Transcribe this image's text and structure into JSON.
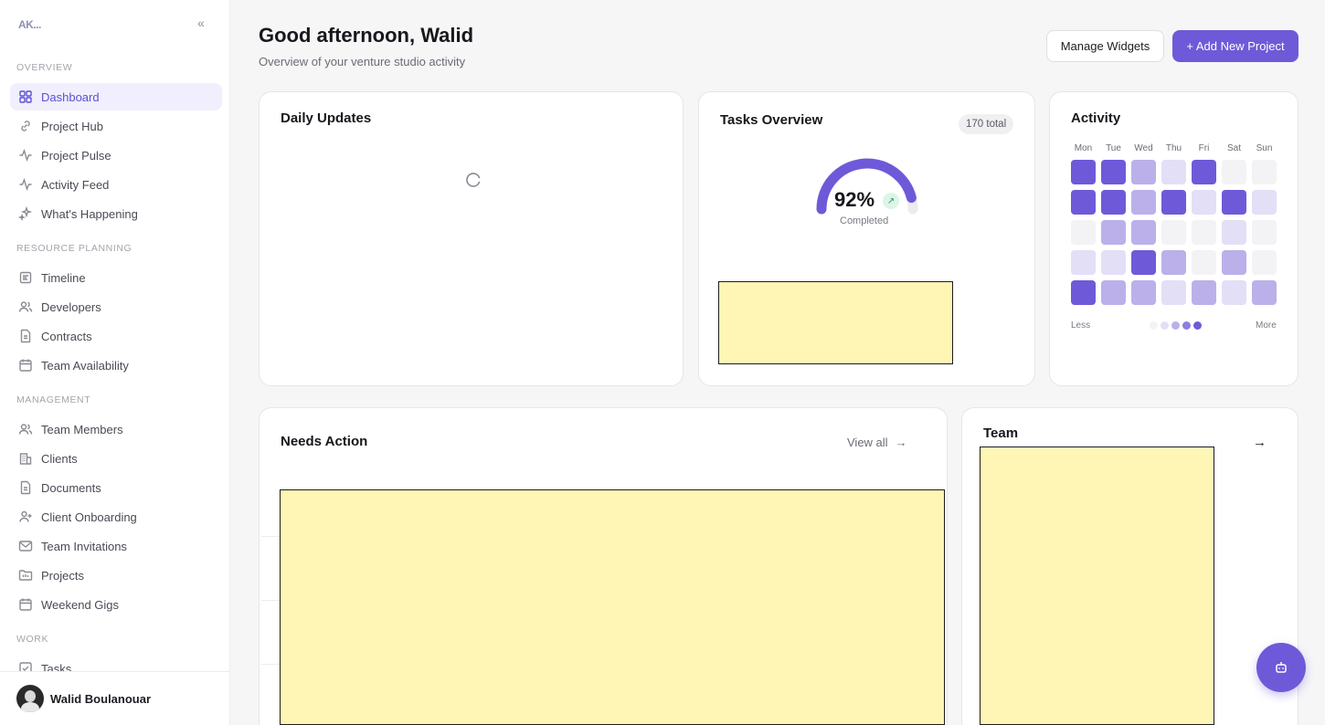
{
  "logo_text": "AK...",
  "sidebar": {
    "sections": [
      {
        "label": "OVERVIEW",
        "items": [
          {
            "label": "Dashboard",
            "icon": "grid-icon",
            "active": true
          },
          {
            "label": "Project Hub",
            "icon": "link-icon"
          },
          {
            "label": "Project Pulse",
            "icon": "pulse-icon"
          },
          {
            "label": "Activity Feed",
            "icon": "pulse-icon"
          },
          {
            "label": "What's Happening",
            "icon": "sparkle-icon"
          }
        ]
      },
      {
        "label": "RESOURCE PLANNING",
        "items": [
          {
            "label": "Timeline",
            "icon": "timeline-icon"
          },
          {
            "label": "Developers",
            "icon": "users-icon"
          },
          {
            "label": "Contracts",
            "icon": "document-icon"
          },
          {
            "label": "Team Availability",
            "icon": "calendar-icon"
          }
        ]
      },
      {
        "label": "MANAGEMENT",
        "items": [
          {
            "label": "Team Members",
            "icon": "users-icon"
          },
          {
            "label": "Clients",
            "icon": "building-icon"
          },
          {
            "label": "Documents",
            "icon": "document-icon"
          },
          {
            "label": "Client Onboarding",
            "icon": "user-plus-icon"
          },
          {
            "label": "Team Invitations",
            "icon": "mail-icon"
          },
          {
            "label": "Projects",
            "icon": "folder-icon"
          },
          {
            "label": "Weekend Gigs",
            "icon": "calendar-icon"
          }
        ]
      },
      {
        "label": "WORK",
        "items": [
          {
            "label": "Tasks",
            "icon": "checkbox-icon"
          }
        ]
      }
    ],
    "user": {
      "name": "Walid Boulanouar"
    }
  },
  "header": {
    "greeting": "Good afternoon, Walid",
    "subtitle": "Overview of your venture studio activity",
    "manage_widgets": "Manage Widgets",
    "add_project": "+ Add New Project"
  },
  "daily_updates": {
    "title": "Daily Updates"
  },
  "tasks_overview": {
    "title": "Tasks Overview",
    "total": "170 total",
    "percent": "92%",
    "completion_fraction": 0.92,
    "completed_label": "Completed"
  },
  "activity": {
    "title": "Activity",
    "days": [
      "Mon",
      "Tue",
      "Wed",
      "Thu",
      "Fri",
      "Sat",
      "Sun"
    ],
    "levels": [
      [
        4,
        4,
        2,
        1,
        4,
        0,
        0
      ],
      [
        4,
        4,
        2,
        4,
        1,
        4,
        1
      ],
      [
        0,
        2,
        2,
        0,
        0,
        1,
        0
      ],
      [
        1,
        1,
        4,
        2,
        0,
        2,
        0
      ],
      [
        4,
        2,
        2,
        1,
        2,
        1,
        2
      ]
    ],
    "level_colors": [
      "#f3f3f5",
      "#e3dff7",
      "#bbb0ea",
      "#8d7ee0",
      "#6e5ad8"
    ],
    "less": "Less",
    "more": "More"
  },
  "needs_action": {
    "title": "Needs Action",
    "view_all": "View all"
  },
  "team": {
    "title": "Team"
  },
  "colors": {
    "accent": "#6e5ad8",
    "active_bg": "#f1effd"
  }
}
